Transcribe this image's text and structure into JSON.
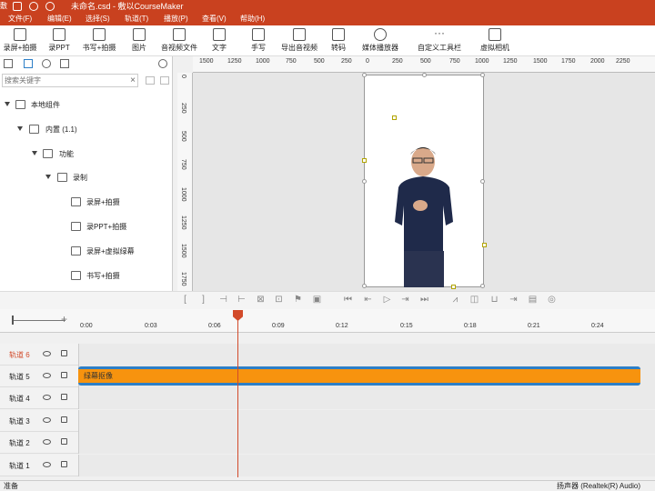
{
  "app": {
    "icon_text": "敷",
    "title": "未命名.csd - 敷以CourseMaker"
  },
  "menu": [
    "文件(F)",
    "编辑(E)",
    "选择(S)",
    "轨道(T)",
    "播放(P)",
    "查看(V)",
    "帮助(H)"
  ],
  "toolbar": [
    {
      "label": "录屏+拍摄",
      "icon": "record-camera-icon"
    },
    {
      "label": "录PPT",
      "icon": "ppt-icon"
    },
    {
      "label": "书写+拍摄",
      "icon": "write-camera-icon"
    },
    {
      "label": "图片",
      "icon": "image-icon"
    },
    {
      "label": "音视频文件",
      "icon": "media-file-icon"
    },
    {
      "label": "文字",
      "icon": "text-icon"
    },
    {
      "label": "手写",
      "icon": "pen-icon"
    },
    {
      "label": "导出音视频",
      "icon": "export-icon"
    },
    {
      "label": "转码",
      "icon": "transcode-icon"
    },
    {
      "label": "媒体播放器",
      "icon": "player-icon"
    },
    {
      "label": "自定义工具栏",
      "icon": "more-icon"
    },
    {
      "label": "虚拟相机",
      "icon": "virtual-camera-icon"
    }
  ],
  "left_panel": {
    "search_placeholder": "搜索关键字",
    "tree": [
      {
        "label": "本地组件",
        "level": 0
      },
      {
        "label": "内置 (1.1)",
        "level": 1
      },
      {
        "label": "功能",
        "level": 2
      },
      {
        "label": "录制",
        "level": 3
      },
      {
        "label": "录屏+拍摄",
        "level": 4
      },
      {
        "label": "录PPT+拍摄",
        "level": 4
      },
      {
        "label": "录屏+虚拟绿幕",
        "level": 4
      },
      {
        "label": "书写+拍摄",
        "level": 4
      }
    ]
  },
  "ruler": {
    "h_ticks": [
      "1500",
      "1250",
      "1000",
      "750",
      "500",
      "250",
      "0",
      "250",
      "500",
      "750",
      "1000",
      "1250",
      "1500",
      "1750",
      "2000",
      "2250"
    ],
    "v_ticks": [
      "0",
      "250",
      "500",
      "750",
      "1000",
      "1250",
      "1500",
      "1750"
    ]
  },
  "timeline": {
    "ticks": [
      "0:00",
      "0:03",
      "0:06",
      "0:09",
      "0:12",
      "0:15",
      "0:18",
      "0:21",
      "0:24"
    ],
    "tracks": [
      "轨道 6",
      "轨道 5",
      "轨道 4",
      "轨道 3",
      "轨道 2",
      "轨道 1"
    ],
    "clip_label": "绿幕抠像",
    "clip_color": "#f7930e",
    "active_track_color": "#d24a2a"
  },
  "status": {
    "left": "准备",
    "right": "扬声器 (Realtek(R) Audio)"
  }
}
